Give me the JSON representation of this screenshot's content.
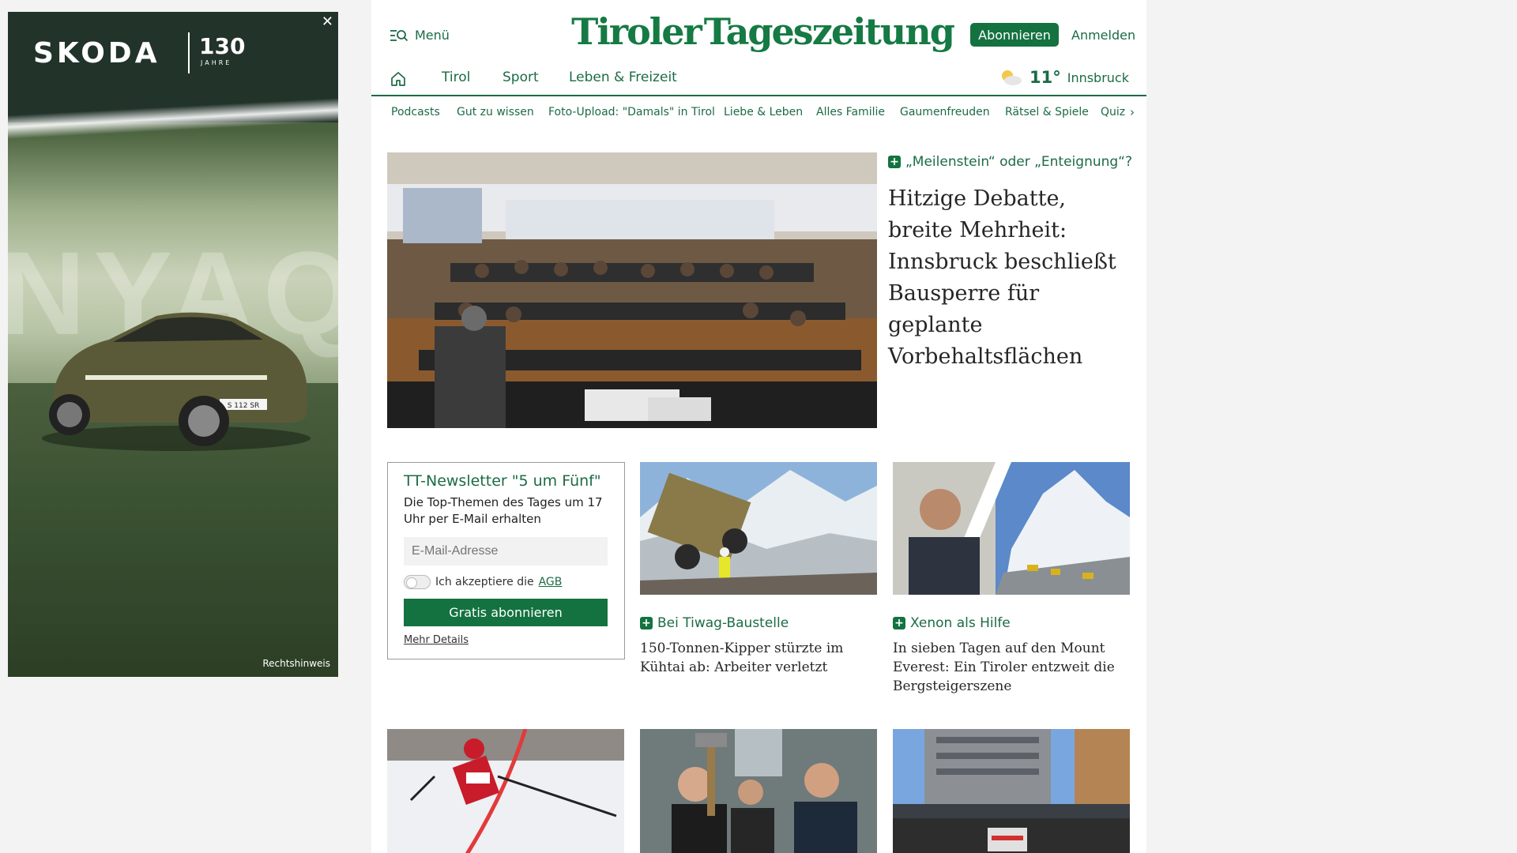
{
  "ad": {
    "brand": "SKODA",
    "years": "130",
    "years_sub": "JAHRE",
    "bg_word": "NYAQ",
    "plate": "S 112 SR",
    "close": "✕",
    "legal": "Rechtshinweis"
  },
  "header": {
    "menu_label": "Menü",
    "logo_left": "Tiroler",
    "logo_right": "Tageszeitung",
    "subscribe": "Abonnieren",
    "login": "Anmelden"
  },
  "nav": {
    "items": [
      "Tirol",
      "Sport",
      "Leben & Freizeit"
    ],
    "weather_temp": "11°",
    "weather_city": "Innsbruck"
  },
  "subnav": {
    "items": [
      "Podcasts",
      "Gut zu wissen",
      "Foto-Upload: \"Damals\" in Tirol",
      "Liebe & Leben",
      "Alles Familie",
      "Gaumenfreuden",
      "Rätsel & Spiele",
      "Quiz"
    ],
    "next": "›"
  },
  "hero": {
    "kicker": "„Meilenstein“ oder „Enteignung“?",
    "title": "Hitzige Debatte, breite Mehrheit: Innsbruck beschließt Bausperre für geplante Vorbehaltsflächen"
  },
  "newsletter": {
    "title": "TT-Newsletter \"5 um Fünf\"",
    "desc": "Die Top-Themen des Tages um 17 Uhr per E-Mail erhalten",
    "placeholder": "E-Mail-Adresse",
    "check_label": "Ich akzeptiere die",
    "agb": "AGB",
    "button": "Gratis abonnieren",
    "more": "Mehr Details"
  },
  "articles": [
    {
      "kicker": "Bei Tiwag-Baustelle",
      "title": "150-Tonnen-Kipper stürzte im Kühtai ab: Arbeiter verletzt"
    },
    {
      "kicker": "Xenon als Hilfe",
      "title": "In sieben Tagen auf den Mount Everest: Ein Tiroler entzweit die Bergsteigerszene"
    }
  ],
  "colors": {
    "brand_green": "#147240",
    "link_green": "#1c6b45"
  }
}
